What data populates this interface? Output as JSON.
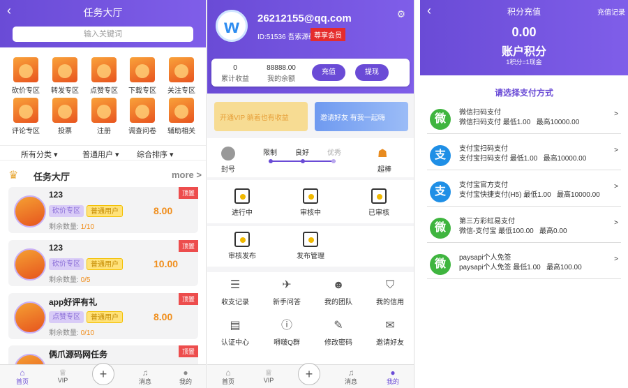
{
  "p1": {
    "title": "任务大厅",
    "search_placeholder": "输入关键词",
    "categories": [
      "砍价专区",
      "转发专区",
      "点赞专区",
      "下载专区",
      "关注专区",
      "评论专区",
      "投票",
      "注册",
      "调查问卷",
      "辅助相关"
    ],
    "filters": [
      "所有分类",
      "普通用户",
      "综合排序"
    ],
    "hall_title": "任务大厅",
    "more": "more >",
    "tasks": [
      {
        "name": "123",
        "tag1": "砍价专区",
        "tag2": "普通用户",
        "price": "8.00",
        "remain_label": "剩余数量:",
        "remain": "1/10",
        "pin": "顶置"
      },
      {
        "name": "123",
        "tag1": "砍价专区",
        "tag2": "普通用户",
        "price": "10.00",
        "remain_label": "剩余数量:",
        "remain": "0/5",
        "pin": "顶置"
      },
      {
        "name": "app好评有礼",
        "tag1": "点赞专区",
        "tag2": "普通用户",
        "price": "8.00",
        "remain_label": "剩余数量:",
        "remain": "0/10",
        "pin": "顶置"
      },
      {
        "name": "俩爪源码网任务",
        "pin": "顶置"
      }
    ],
    "tabs": [
      "首页",
      "VIP",
      "+",
      "消息",
      "我的"
    ]
  },
  "p2": {
    "email": "26212155@qq.com",
    "id": "ID:51536 吾索源码",
    "vip": "尊享会员",
    "income_val": "0",
    "income_label": "累计收益",
    "balance_val": "88888.00",
    "balance_label": "我的余额",
    "recharge": "充值",
    "withdraw": "提现",
    "banner1": "开通VIP 躺着也有收益",
    "banner2": "邀请好友 有我一起嗨",
    "seal": "封号",
    "levels": [
      "限制",
      "良好",
      "优秀"
    ],
    "bang": "超棒",
    "row1": [
      "进行中",
      "审核中",
      "已审核"
    ],
    "row2": [
      "审核发布",
      "发布管理"
    ],
    "grid": [
      "收支记录",
      "新手问答",
      "我的团队",
      "我的信用",
      "认证中心",
      "嘚啵Q群",
      "修改密码",
      "邀请好友"
    ],
    "tabs": [
      "首页",
      "VIP",
      "+",
      "消息",
      "我的"
    ]
  },
  "p3": {
    "title": "积分充值",
    "record": "充值记录",
    "amount": "0.00",
    "account": "账户积分",
    "rate": "1积分=1现金",
    "choose": "请选择支付方式",
    "methods": [
      {
        "name": "微信扫码支付",
        "desc": "微信扫码支付 最低1.00",
        "max": "最高10000.00",
        "icon": "微",
        "color": "#3fb53f"
      },
      {
        "name": "支付宝扫码支付",
        "desc": "支付宝扫码支付 最低1.00",
        "max": "最高10000.00",
        "icon": "支",
        "color": "#1f8fe6"
      },
      {
        "name": "支付宝官方支付",
        "desc": "支付宝快捷支付(H5) 最低1.00",
        "max": "最高10000.00",
        "icon": "支",
        "color": "#1f8fe6"
      },
      {
        "name": "第三方彩虹易支付",
        "desc": "微信-支付宝 最低100.00",
        "max": "最高0.00",
        "icon": "微",
        "color": "#3fb53f"
      },
      {
        "name": "paysapi个人免签",
        "desc": "paysapi个人免签 最低1.00",
        "max": "最高100.00",
        "icon": "微",
        "color": "#3fb53f"
      }
    ]
  }
}
